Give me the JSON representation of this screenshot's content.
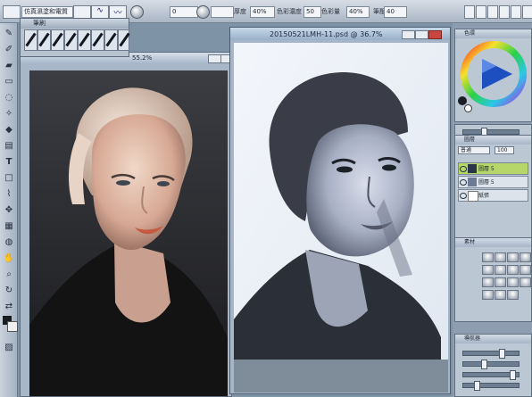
{
  "topbar": {
    "labels": [
      "厚度",
      "色彩濃度",
      "色彩量",
      "筆壓"
    ],
    "values": [
      "0",
      "50",
      "40%",
      "40%",
      "40"
    ],
    "preset": "仿真濕塗和電質"
  },
  "brush_palette": {
    "title": "筆刷"
  },
  "photo_window": {
    "zoom": "55.2%"
  },
  "paint_window": {
    "title": "20150521LMH-11.psd @ 36.7%"
  },
  "panels": {
    "color": {
      "title": "色環"
    },
    "layer": {
      "title": "圖層",
      "blend_mode": "普通",
      "opacity": "100",
      "layers": [
        "圖層 5",
        "圖層 5",
        "紙張"
      ]
    },
    "material": {
      "title": "素材"
    },
    "navigator": {
      "title": "導航器"
    }
  },
  "colors": {
    "active_layer": "#b7d66a",
    "selected_hue": "#2c6ad3"
  }
}
